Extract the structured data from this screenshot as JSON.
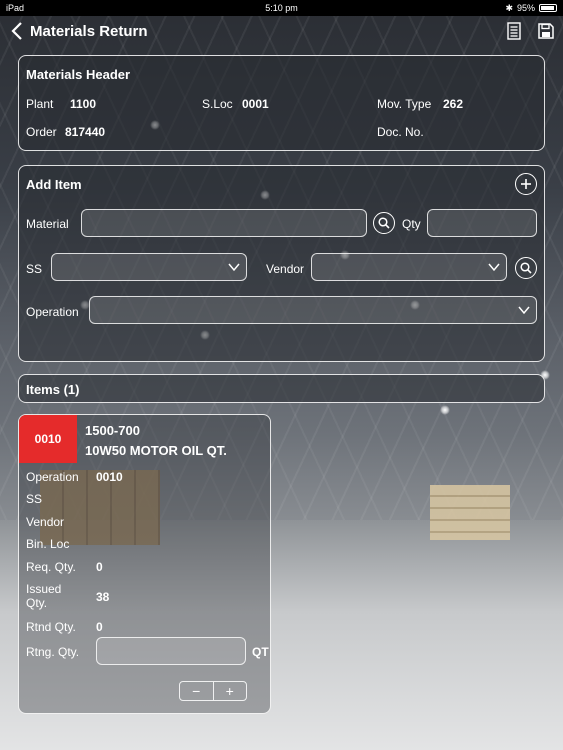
{
  "status_bar": {
    "carrier": "iPad",
    "time": "5:10 pm",
    "battery": "95%"
  },
  "nav": {
    "title": "Materials Return"
  },
  "header_panel": {
    "title": "Materials Header",
    "plant_label": "Plant",
    "plant_value": "1100",
    "sloc_label": "S.Loc",
    "sloc_value": "0001",
    "movtype_label": "Mov. Type",
    "movtype_value": "262",
    "order_label": "Order",
    "order_value": "817440",
    "docno_label": "Doc. No.",
    "docno_value": ""
  },
  "add_item": {
    "title": "Add Item",
    "material_label": "Material",
    "material_value": "",
    "qty_label": "Qty",
    "qty_value": "",
    "ss_label": "SS",
    "ss_value": "",
    "vendor_label": "Vendor",
    "vendor_value": "",
    "operation_label": "Operation",
    "operation_value": ""
  },
  "items_header": {
    "label": "Items (1)"
  },
  "item": {
    "position": "0010",
    "material_no": "1500-700",
    "description": "10W50 MOTOR OIL QT.",
    "operation_label": "Operation",
    "operation_value": "0010",
    "ss_label": "SS",
    "ss_value": "",
    "vendor_label": "Vendor",
    "vendor_value": "",
    "binloc_label": "Bin. Loc",
    "binloc_value": "",
    "reqqty_label": "Req. Qty.",
    "reqqty_value": "0",
    "issuedqty_label": "Issued Qty.",
    "issuedqty_value": "38",
    "rtndqty_label": "Rtnd Qty.",
    "rtndqty_value": "0",
    "rtngqty_label": "Rtng. Qty.",
    "rtngqty_value": "",
    "unit": "QT",
    "stepper_minus": "−",
    "stepper_plus": "+"
  },
  "colors": {
    "badge": "#e52b2b"
  }
}
